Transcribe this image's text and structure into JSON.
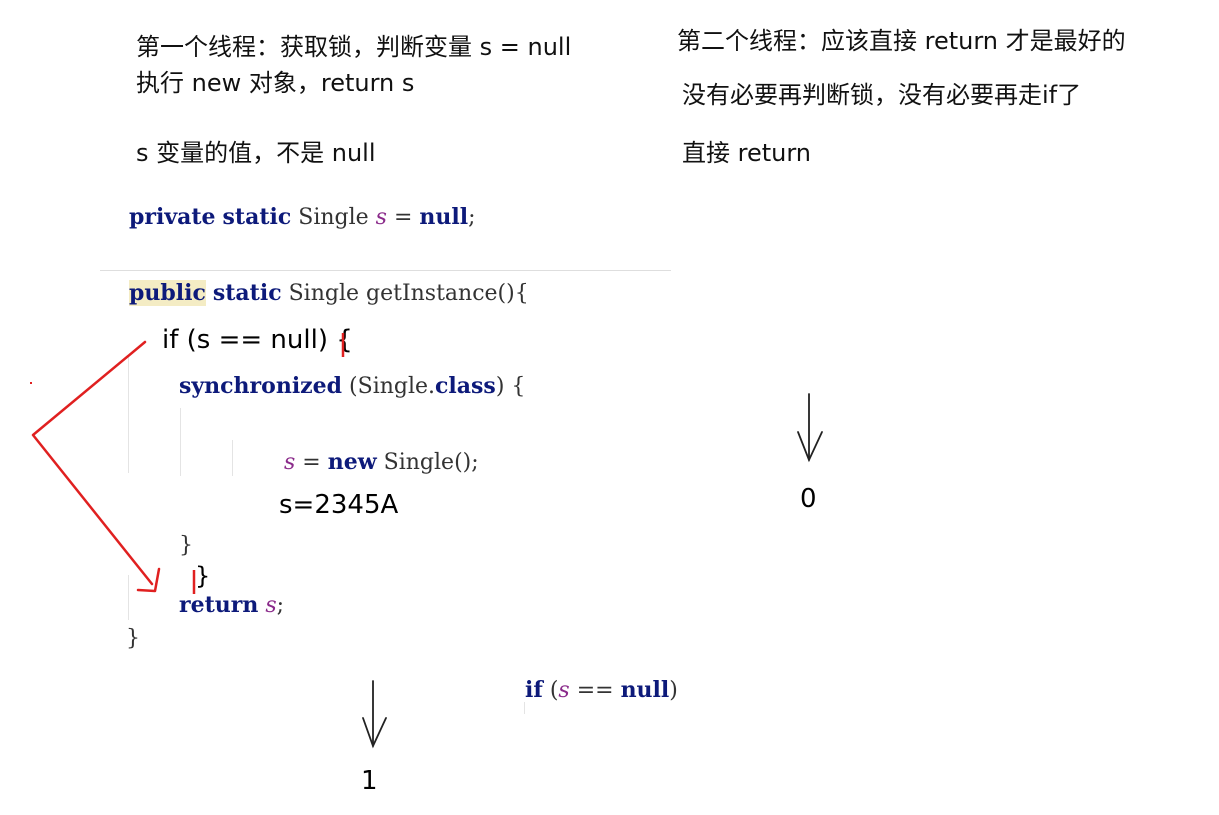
{
  "notes": {
    "thread1_line1": "第一个线程：获取锁，判断变量 s = null",
    "thread1_line2": "执行 new 对象，return s",
    "thread1_line3": "s 变量的值，不是 null",
    "thread2_line1": "第二个线程：应该直接 return 才是最好的",
    "thread2_line2": "没有必要再判断锁，没有必要再走if了",
    "thread2_line3": "直接 return"
  },
  "code": {
    "field_decl": {
      "private": "private",
      "static": "static",
      "type": " Single ",
      "var": "s",
      "assign": " = ",
      "null": "null",
      "semi": ";"
    },
    "method_sig": {
      "public": "public",
      "static": "static",
      "rest": "  Single getInstance(){"
    },
    "handwritten_if": "if (s == null) {",
    "sync": {
      "kw": "synchronized",
      "rest": " (Single.",
      "class": "class",
      "close": ") {"
    },
    "assign_line": {
      "var": "s",
      "eq": " = ",
      "new": "new",
      "rest": " Single();"
    },
    "handwritten_value": "s=2345A",
    "close_brace_inner": "}",
    "handwritten_close": "}",
    "return_line": {
      "kw": "return",
      "sp": " ",
      "var": "s",
      "semi": ";"
    },
    "close_brace_outer": "}",
    "bottom_if": {
      "if": "if",
      "open": " (",
      "var": "s",
      "op": " == ",
      "null": "null",
      "close": ")"
    }
  },
  "markers": {
    "right_value": "0",
    "bottom_value": "1"
  },
  "colors": {
    "annotation_red": "#e02020",
    "keyword": "#0d1a7a",
    "field": "#8a2a8a",
    "highlight": "#f4ecc4"
  }
}
